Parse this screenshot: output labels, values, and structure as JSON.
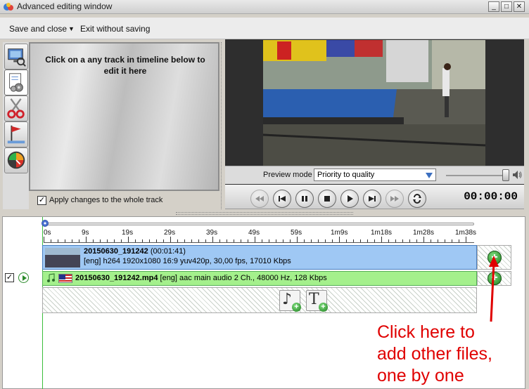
{
  "window": {
    "title": "Advanced editing window",
    "controls": [
      "minimize-icon",
      "maximize-icon",
      "close-icon"
    ]
  },
  "menu": {
    "save_close": "Save and close",
    "exit_without_saving": "Exit without saving"
  },
  "left_tabs": [
    {
      "name": "preview-tab",
      "icon": "monitor-magnifier-icon",
      "active": false
    },
    {
      "name": "settings-tab",
      "icon": "document-gears-icon",
      "active": true
    },
    {
      "name": "cut-tab",
      "icon": "scissors-icon",
      "active": false
    },
    {
      "name": "chapters-tab",
      "icon": "flag-marker-icon",
      "active": false
    },
    {
      "name": "effects-tab",
      "icon": "gauge-icon",
      "active": false
    }
  ],
  "edit_panel": {
    "message": "Click on a any track in timeline below to edit it here",
    "apply_checked": true,
    "apply_label": "Apply changes to the whole track"
  },
  "preview": {
    "mode_label": "Preview mode",
    "mode_value": "Priority to quality",
    "volume_level": 0.95,
    "timecode": "00:00:00"
  },
  "transport_buttons": [
    {
      "name": "rewind-button",
      "icon": "rewind-icon",
      "enabled": false
    },
    {
      "name": "previous-button",
      "icon": "skip-previous-icon",
      "enabled": true
    },
    {
      "name": "pause-button",
      "icon": "pause-icon",
      "enabled": true
    },
    {
      "name": "stop-button",
      "icon": "stop-icon",
      "enabled": true
    },
    {
      "name": "play-button",
      "icon": "play-icon",
      "enabled": true
    },
    {
      "name": "next-button",
      "icon": "skip-next-icon",
      "enabled": true
    },
    {
      "name": "fast-forward-button",
      "icon": "fast-forward-icon",
      "enabled": false
    },
    {
      "name": "loop-button",
      "icon": "loop-icon",
      "enabled": true
    }
  ],
  "timeline": {
    "ruler_labels": [
      "0s",
      "9s",
      "19s",
      "29s",
      "39s",
      "49s",
      "59s",
      "1m9s",
      "1m18s",
      "1m28s",
      "1m38s"
    ],
    "video_track": {
      "name": "20150630_191242",
      "duration": "(00:01:41)",
      "info": "[eng] h264 1920x1080 16:9 yuv420p, 30,00 fps, 17010 Kbps"
    },
    "audio_track": {
      "checked": true,
      "file": "20150630_191242.mp4",
      "info": "[eng] aac main audio 2 Ch., 48000 Hz, 128 Kbps"
    },
    "add_buttons_label": "+",
    "add_audio_glyph": "♪",
    "add_text_glyph": "T"
  },
  "annotation": {
    "lines": [
      "Click here to",
      "add other files,",
      "one by one"
    ],
    "color": "#e00000"
  }
}
